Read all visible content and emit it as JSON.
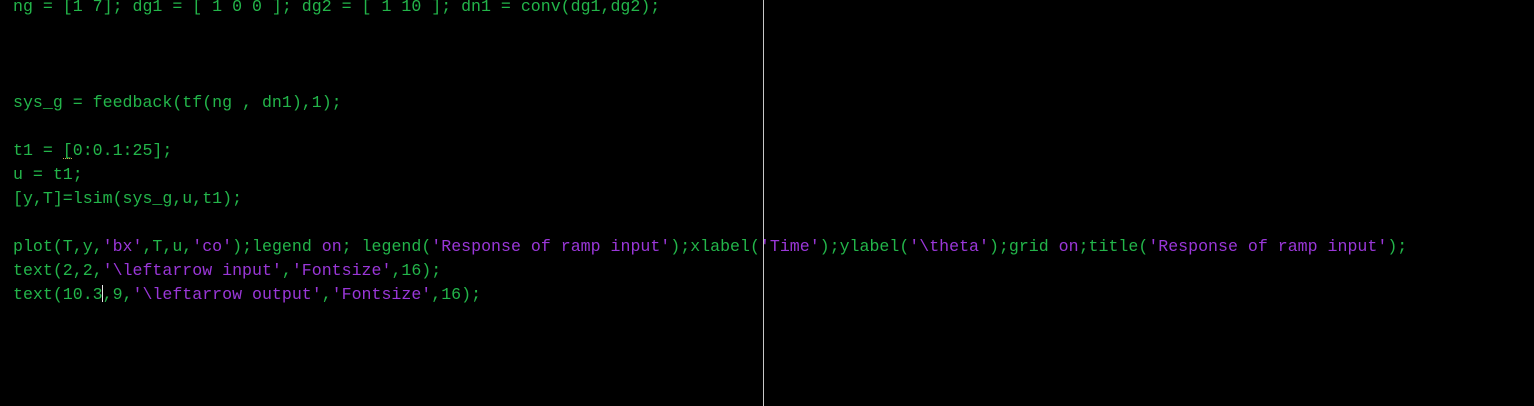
{
  "editor": {
    "lines": {
      "l1": {
        "code": "ng = [1 7]; dg1 = [ 1 0 0 ]; dg2 = [ 1 10 ]; dn1 = conv(dg1,dg2);"
      },
      "l2": {
        "code": "sys_g = feedback(tf(ng , dn1),1);"
      },
      "l3": {
        "code": "t1 = [0:0.1:25];"
      },
      "l4": {
        "code": "u = t1;"
      },
      "l5": {
        "code": "[y,T]=lsim(sys_g,u,t1);"
      },
      "l6": {
        "p1": "plot(T,y,",
        "s1": "'bx'",
        "p2": ",T,u,",
        "s2": "'co'",
        "p3": ");legend ",
        "k1": "on",
        "p4": "; legend(",
        "s3": "'Response of ramp input'",
        "p5": ");xlabel(",
        "s4": "'Time'",
        "p6": ");ylabel(",
        "s5": "'\\theta'",
        "p7": ");grid ",
        "k2": "on",
        "p8": ";title(",
        "s6": "'Response of ramp input'",
        "p9": ");"
      },
      "l7": {
        "p1": "text(2,2,",
        "s1": "'\\leftarrow input'",
        "p2": ",",
        "s2": "'Fontsize'",
        "p3": ",16);"
      },
      "l8": {
        "p1": "text(10.3",
        "p2": ",9,",
        "s1": "'\\leftarrow output'",
        "p3": ",",
        "s2": "'Fontsize'",
        "p4": ",16);"
      }
    }
  },
  "colors": {
    "background": "#000000",
    "code": "#23b54a",
    "string": "#9a37d8",
    "margin_line": "#c8c8c8"
  }
}
